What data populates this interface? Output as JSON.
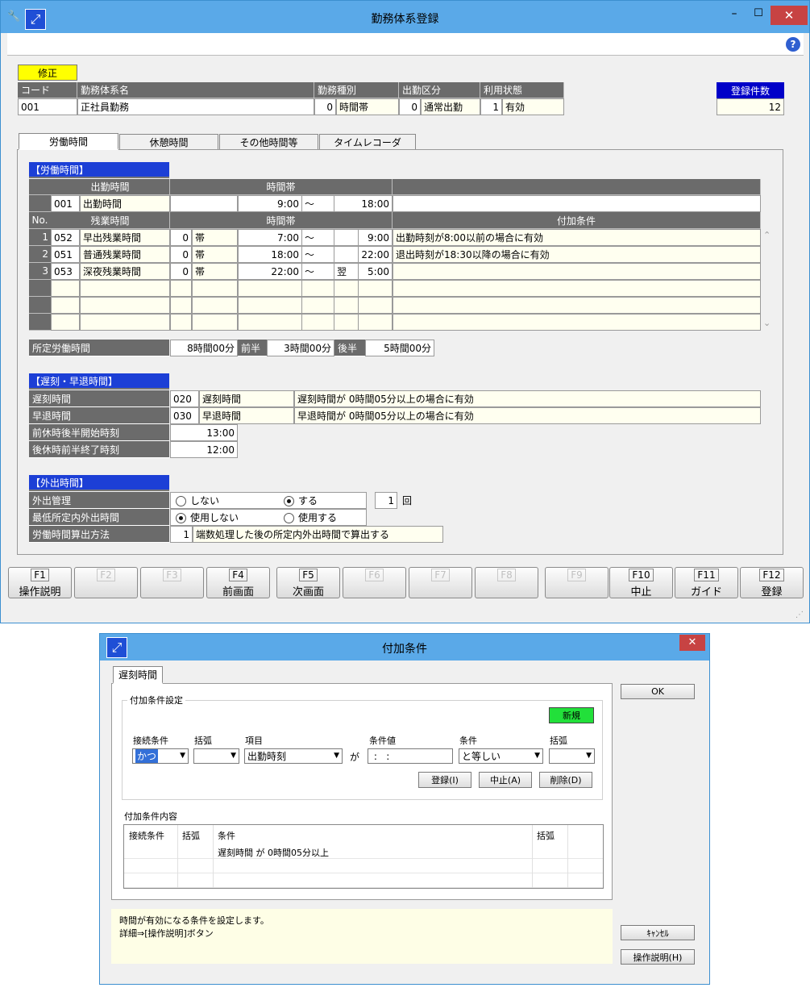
{
  "main": {
    "title": "勤務体系登録",
    "mode_badge": "修正",
    "header": {
      "cols": [
        "コード",
        "勤務体系名",
        "勤務種別",
        "出勤区分",
        "利用状態"
      ],
      "code": "001",
      "name": "正社員勤務",
      "work_type_num": "0",
      "work_type": "時間帯",
      "attend_num": "0",
      "attend": "通常出勤",
      "status_num": "1",
      "status": "有効",
      "count_label": "登録件数",
      "count": "12"
    },
    "tabs": [
      "労働時間",
      "休憩時間",
      "その他時間等",
      "タイムレコーダ"
    ],
    "labor": {
      "section": "【労働時間】",
      "attend_hdr": "出勤時間",
      "timeband_hdr": "時間帯",
      "attend_row": {
        "code": "001",
        "name": "出勤時間",
        "start": "9:00",
        "tilde": "～",
        "end": "18:00"
      },
      "no_hdr": "No.",
      "ot_hdr": "残業時間",
      "ot_time_hdr": "時間帯",
      "cond_hdr": "付加条件",
      "ot_rows": [
        {
          "no": "1",
          "code": "052",
          "name": "早出残業時間",
          "n": "0",
          "band": "帯",
          "start": "7:00",
          "tilde": "～",
          "next": "",
          "end": "9:00",
          "cond": "出勤時刻が8:00以前の場合に有効"
        },
        {
          "no": "2",
          "code": "051",
          "name": "普通残業時間",
          "n": "0",
          "band": "帯",
          "start": "18:00",
          "tilde": "～",
          "next": "",
          "end": "22:00",
          "cond": "退出時刻が18:30以降の場合に有効"
        },
        {
          "no": "3",
          "code": "053",
          "name": "深夜残業時間",
          "n": "0",
          "band": "帯",
          "start": "22:00",
          "tilde": "～",
          "next": "翌",
          "end": "5:00",
          "cond": ""
        }
      ],
      "scheduled_label": "所定労働時間",
      "scheduled_value": "8時間00分",
      "first_half_label": "前半",
      "first_half_value": "3時間00分",
      "second_half_label": "後半",
      "second_half_value": "5時間00分"
    },
    "late": {
      "section": "【遅刻・早退時間】",
      "rows": [
        {
          "label": "遅刻時間",
          "code": "020",
          "name": "遅刻時間",
          "cond": "遅刻時間が 0時間05分以上の場合に有効"
        },
        {
          "label": "早退時間",
          "code": "030",
          "name": "早退時間",
          "cond": "早退時間が 0時間05分以上の場合に有効"
        }
      ],
      "break_start_label": "前休時後半開始時刻",
      "break_start": "13:00",
      "break_end_label": "後休時前半終了時刻",
      "break_end": "12:00"
    },
    "outing": {
      "section": "【外出時間】",
      "mgmt_label": "外出管理",
      "mgmt_opt1": "しない",
      "mgmt_opt2": "する",
      "times": "1",
      "times_unit": "回",
      "min_label": "最低所定内外出時間",
      "min_opt1": "使用しない",
      "min_opt2": "使用する",
      "calc_label": "労働時間算出方法",
      "calc_num": "1",
      "calc_text": "端数処理した後の所定内外出時間で算出する"
    },
    "fkeys": [
      {
        "key": "F1",
        "name": "操作説明"
      },
      {
        "key": "F2",
        "name": ""
      },
      {
        "key": "F3",
        "name": ""
      },
      {
        "key": "F4",
        "name": "前画面"
      },
      {
        "key": "F5",
        "name": "次画面"
      },
      {
        "key": "F6",
        "name": ""
      },
      {
        "key": "F7",
        "name": ""
      },
      {
        "key": "F8",
        "name": ""
      },
      {
        "key": "F9",
        "name": ""
      },
      {
        "key": "F10",
        "name": "中止"
      },
      {
        "key": "F11",
        "name": "ガイド"
      },
      {
        "key": "F12",
        "name": "登録"
      }
    ]
  },
  "dialog": {
    "title": "付加条件",
    "tab": "遅刻時間",
    "group_label": "付加条件設定",
    "new_badge": "新規",
    "col_connect": "接続条件",
    "col_paren1": "括弧",
    "col_item": "項目",
    "col_value": "条件値",
    "col_cond": "条件",
    "col_paren2": "括弧",
    "connect_value": "かつ",
    "item_value": "出勤時刻",
    "ga": "が",
    "value_value": " :   :",
    "cond_value": "と等しい",
    "btn_register": "登録(I)",
    "btn_stop": "中止(A)",
    "btn_delete": "削除(D)",
    "content_label": "付加条件内容",
    "list_cols": [
      "接続条件",
      "括弧",
      "条件",
      "括弧"
    ],
    "list_row": "遅刻時間 が  0時間05分以上",
    "ok": "OK",
    "cancel": "ｷｬﾝｾﾙ",
    "help": "操作説明(H)",
    "help_text1": "時間が有効になる条件を設定します。",
    "help_text2": "詳細⇒[操作説明]ボタン"
  }
}
